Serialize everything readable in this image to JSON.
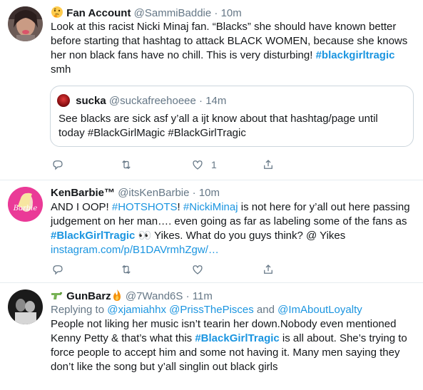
{
  "tweets": [
    {
      "name": "Fan Account",
      "handle": "@SammiBaddie",
      "dot": "·",
      "time": "10m",
      "text_segments": [
        {
          "t": "Look at this racist Nicki Minaj fan. “Blacks” she should have known better before starting that hashtag to attack BLACK WOMEN, because she knows her non black fans have no chill. This is very disturbing! ",
          "k": "plain"
        },
        {
          "t": "#blackgirltragic",
          "k": "tag"
        },
        {
          "t": " smh",
          "k": "plain"
        }
      ],
      "quote": {
        "name": "sucka",
        "handle": "@suckafreehoeee",
        "dot": "·",
        "time": "14m",
        "text": "See blacks are sick asf y’all a ijt know about that hashtag/page until today #BlackGirlMagic #BlackGirlTragic"
      },
      "like_count": "1"
    },
    {
      "name": "KenBarbie™",
      "handle": "@itsKenBarbie",
      "dot": "·",
      "time": "10m",
      "avatar_label": "Barbie",
      "text_segments": [
        {
          "t": "AND I OOP! ",
          "k": "plain"
        },
        {
          "t": "#HOTSHOTS",
          "k": "link"
        },
        {
          "t": "! ",
          "k": "plain"
        },
        {
          "t": "#NickiMinaj",
          "k": "link"
        },
        {
          "t": " is not here for y’all out here passing judgement on her man…. even going as far as labeling some of the fans as ",
          "k": "plain"
        },
        {
          "t": "#BlackGirlTragic",
          "k": "tag"
        },
        {
          "t": " 👀 Yikes. What do you guys think? @ Yikes ",
          "k": "plain"
        },
        {
          "t": "instagram.com/p/B1DAVrmhZgw/…",
          "k": "link"
        }
      ]
    },
    {
      "name": "GunBarz",
      "handle": "@7Wand6S",
      "dot": "·",
      "time": "11m",
      "replying_prefix": "Replying to ",
      "replying_users": [
        "@xjamiahhx",
        "@PrissThePisces"
      ],
      "replying_and": " and ",
      "replying_last": "@ImAboutLoyalty",
      "text_segments": [
        {
          "t": "People not liking her music isn’t tearin her down.Nobody even mentioned Kenny Petty & that’s what this ",
          "k": "plain"
        },
        {
          "t": "#BlackGirlTragic",
          "k": "tag"
        },
        {
          "t": " is all about. She’s trying to force people to accept him and some not having it. Many men saying they don’t like the song but y’all singlin out black girls",
          "k": "plain"
        }
      ]
    }
  ],
  "icons": {
    "reply": "reply-icon",
    "retweet": "retweet-icon",
    "like": "like-icon",
    "share": "share-icon",
    "emoji_thinking": "thinking-face-icon",
    "emoji_gun": "water-pistol-icon",
    "emoji_fire": "fire-icon"
  },
  "colors": {
    "link": "#1b95e0",
    "muted": "#657786",
    "text": "#14171a",
    "divider": "#e6ecf0"
  }
}
